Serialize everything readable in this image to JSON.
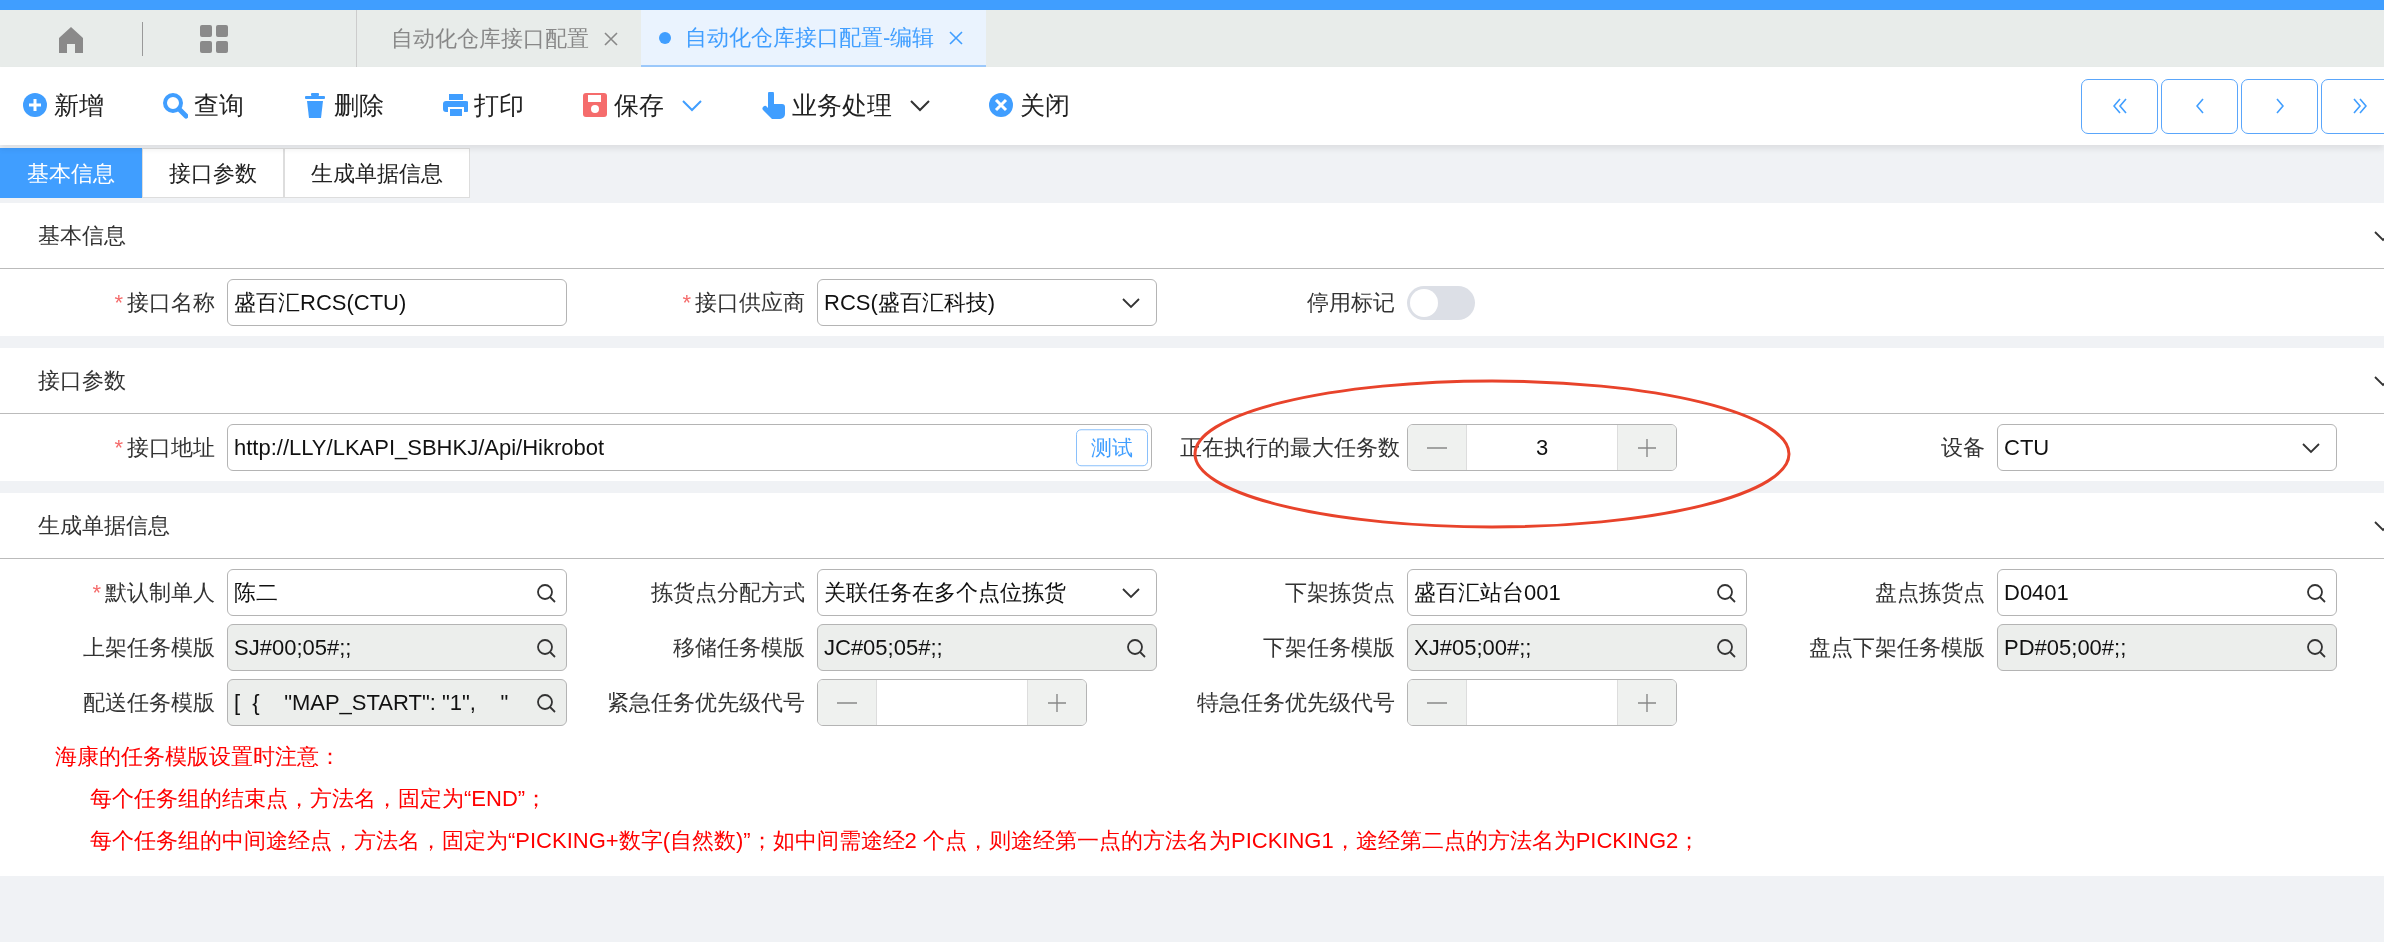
{
  "nav_icons": [
    {
      "kind": "home"
    },
    {
      "kind": "grid"
    }
  ],
  "doc_tabs": [
    {
      "label": "自动化仓库接口配置",
      "selected": false,
      "modified": false
    },
    {
      "label": "自动化仓库接口配置-编辑",
      "selected": true,
      "modified": true
    }
  ],
  "toolbar": [
    {
      "label": "新增",
      "kind": "plus",
      "dropdown": false
    },
    {
      "label": "查询",
      "kind": "search",
      "dropdown": false
    },
    {
      "label": "删除",
      "kind": "trash",
      "dropdown": false
    },
    {
      "label": "打印",
      "kind": "printer",
      "dropdown": false
    },
    {
      "label": "保存",
      "kind": "save",
      "dropdown": true
    },
    {
      "label": "业务处理",
      "kind": "hand",
      "dropdown": true
    },
    {
      "label": "关闭",
      "kind": "close",
      "dropdown": false
    }
  ],
  "pager": [
    {
      "kind": "first"
    },
    {
      "kind": "prev"
    },
    {
      "kind": "next"
    },
    {
      "kind": "last"
    }
  ],
  "sub_tabs": [
    {
      "label": "基本信息",
      "selected": true
    },
    {
      "label": "接口参数",
      "selected": false
    },
    {
      "label": "生成单据信息",
      "selected": false
    }
  ],
  "sections": [
    {
      "title": "基本信息",
      "expanded": true,
      "fields": [
        {
          "kind": "text",
          "required_mark": "*",
          "label": "接口名称",
          "value": "盛百汇RCS(CTU)"
        },
        {
          "kind": "select",
          "required_mark": "*",
          "label": "接口供应商",
          "value": "RCS(盛百汇科技)"
        },
        {
          "kind": "switch",
          "label": "停用标记",
          "on": false
        }
      ]
    },
    {
      "title": "接口参数",
      "expanded": true,
      "fields": [
        {
          "kind": "url",
          "required_mark": "*",
          "label": "接口地址",
          "value": "http://LLY/LKAPI_SBHKJ/Api/Hikrobot",
          "action": "测试"
        },
        {
          "kind": "stepper",
          "label": "正在执行的最大任务数",
          "value": "3"
        },
        {
          "kind": "select",
          "label": "设备",
          "value": "CTU"
        }
      ],
      "annotations": [
        {
          "kind": "ellipse",
          "color": "#e8432b"
        }
      ]
    },
    {
      "title": "生成单据信息",
      "expanded": true,
      "fields": [
        {
          "kind": "lookup",
          "required_mark": "*",
          "label": "默认制单人",
          "value": "陈二",
          "disabled": false
        },
        {
          "kind": "select",
          "label": "拣货点分配方式",
          "value": "关联任务在多个点位拣货"
        },
        {
          "kind": "lookup",
          "label": "下架拣货点",
          "value": "盛百汇站台001",
          "disabled": false
        },
        {
          "kind": "lookup",
          "label": "盘点拣货点",
          "value": "D0401",
          "disabled": false
        },
        {
          "kind": "lookup",
          "label": "上架任务模版",
          "value": "SJ#00;05#;;",
          "disabled": true
        },
        {
          "kind": "lookup",
          "label": "移储任务模版",
          "value": "JC#05;05#;;",
          "disabled": true
        },
        {
          "kind": "lookup",
          "label": "下架任务模版",
          "value": "XJ#05;00#;;",
          "disabled": true
        },
        {
          "kind": "lookup",
          "label": "盘点下架任务模版",
          "value": "PD#05;00#;;",
          "disabled": true
        },
        {
          "kind": "lookup",
          "label": "配送任务模版",
          "value": "[  {    \"MAP_START\": \"1\",    \"",
          "disabled": true
        },
        {
          "kind": "stepper",
          "label": "紧急任务优先级代号"
        },
        {
          "kind": "stepper",
          "label": "特急任务优先级代号"
        }
      ],
      "notes": {
        "title": "海康的任务模版设置时注意：",
        "lines": [
          "每个任务组的结束点，方法名，固定为“END”；",
          "每个任务组的中间途经点，方法名，固定为“PICKING+数字(自然数)”；如中间需途经2 个点，则途经第一点的方法名为PICKING1，途经第二点的方法名为PICKING2；"
        ]
      }
    }
  ]
}
